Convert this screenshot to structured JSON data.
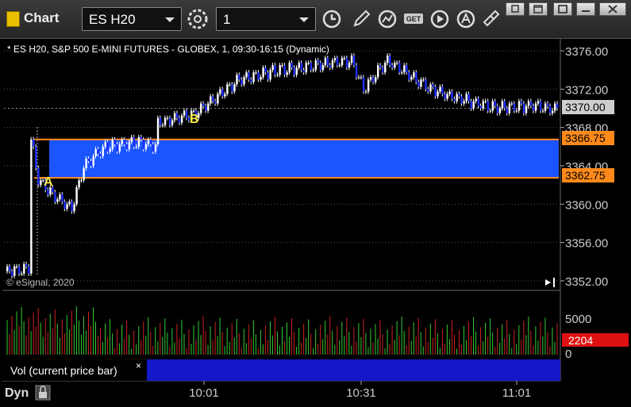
{
  "window": {
    "title": "Chart"
  },
  "toolbar": {
    "symbol": "ES H20",
    "interval": "1",
    "buttons": [
      "gear-icon",
      "clock-icon",
      "pencil-icon",
      "study-icon",
      "get-icon",
      "play-icon",
      "alert-icon",
      "link-icon"
    ],
    "window_controls": [
      "restore-icon",
      "maximize-icon",
      "box-icon",
      "close-icon"
    ]
  },
  "chart": {
    "header": "* ES H20, S&P 500 E-MINI FUTURES - GLOBEX, 1, 09:30-16:15 (Dynamic)",
    "copyright": "© eSignal, 2020",
    "marker_a": "A",
    "marker_b": "B",
    "upper_level_label": "3366.75",
    "lower_level_label": "3362.75",
    "last_price_label": "3370.00",
    "volume_last_label": "2204",
    "volume_panel_label": "Vol (current price bar)",
    "volume_panel_close": "×",
    "mode_label": "Dyn",
    "colors": {
      "background": "#000000",
      "zone": "#1a55ff",
      "zone_border": "#ff8a1a",
      "up_bar": "#ffffff",
      "down_bar": "#1f2fff",
      "vol_up": "#33cc33",
      "vol_down": "#cc2222",
      "grid": "#555555"
    }
  },
  "chart_data": {
    "type": "candlestick",
    "price_axis": {
      "ticks": [
        "3376.00",
        "3372.00",
        "3368.00",
        "3364.00",
        "3360.00",
        "3356.00",
        "3352.00"
      ],
      "ylim": [
        3351.0,
        3377.25
      ]
    },
    "time_axis": {
      "ticks": [
        "10:01",
        "10:31",
        "11:01"
      ]
    },
    "volume_axis": {
      "ticks": [
        "5000",
        "0"
      ]
    },
    "levels": {
      "upper": 3366.75,
      "lower": 3362.75,
      "last": 3370.0
    },
    "volume_last": 2204
  }
}
